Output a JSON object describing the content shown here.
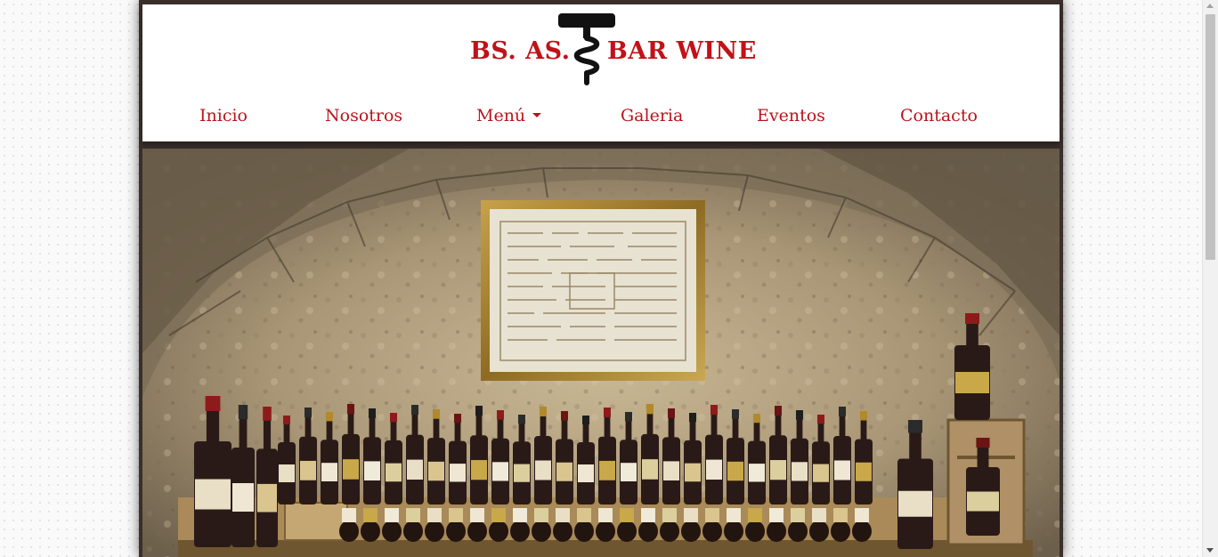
{
  "brand": {
    "left_text": "BS. AS.",
    "right_text": "BAR WINE",
    "icon": "corkscrew-icon",
    "color": "#c01218"
  },
  "nav": {
    "items": [
      {
        "label": "Inicio"
      },
      {
        "label": "Nosotros"
      },
      {
        "label": "Menú",
        "has_dropdown": true
      },
      {
        "label": "Galeria"
      },
      {
        "label": "Eventos"
      },
      {
        "label": "Contacto"
      }
    ],
    "color": "#b8141b"
  },
  "hero": {
    "image": "wine-cellar-photo"
  },
  "colors": {
    "page_frame": "#3a2f2c",
    "accent": "#c01218"
  }
}
